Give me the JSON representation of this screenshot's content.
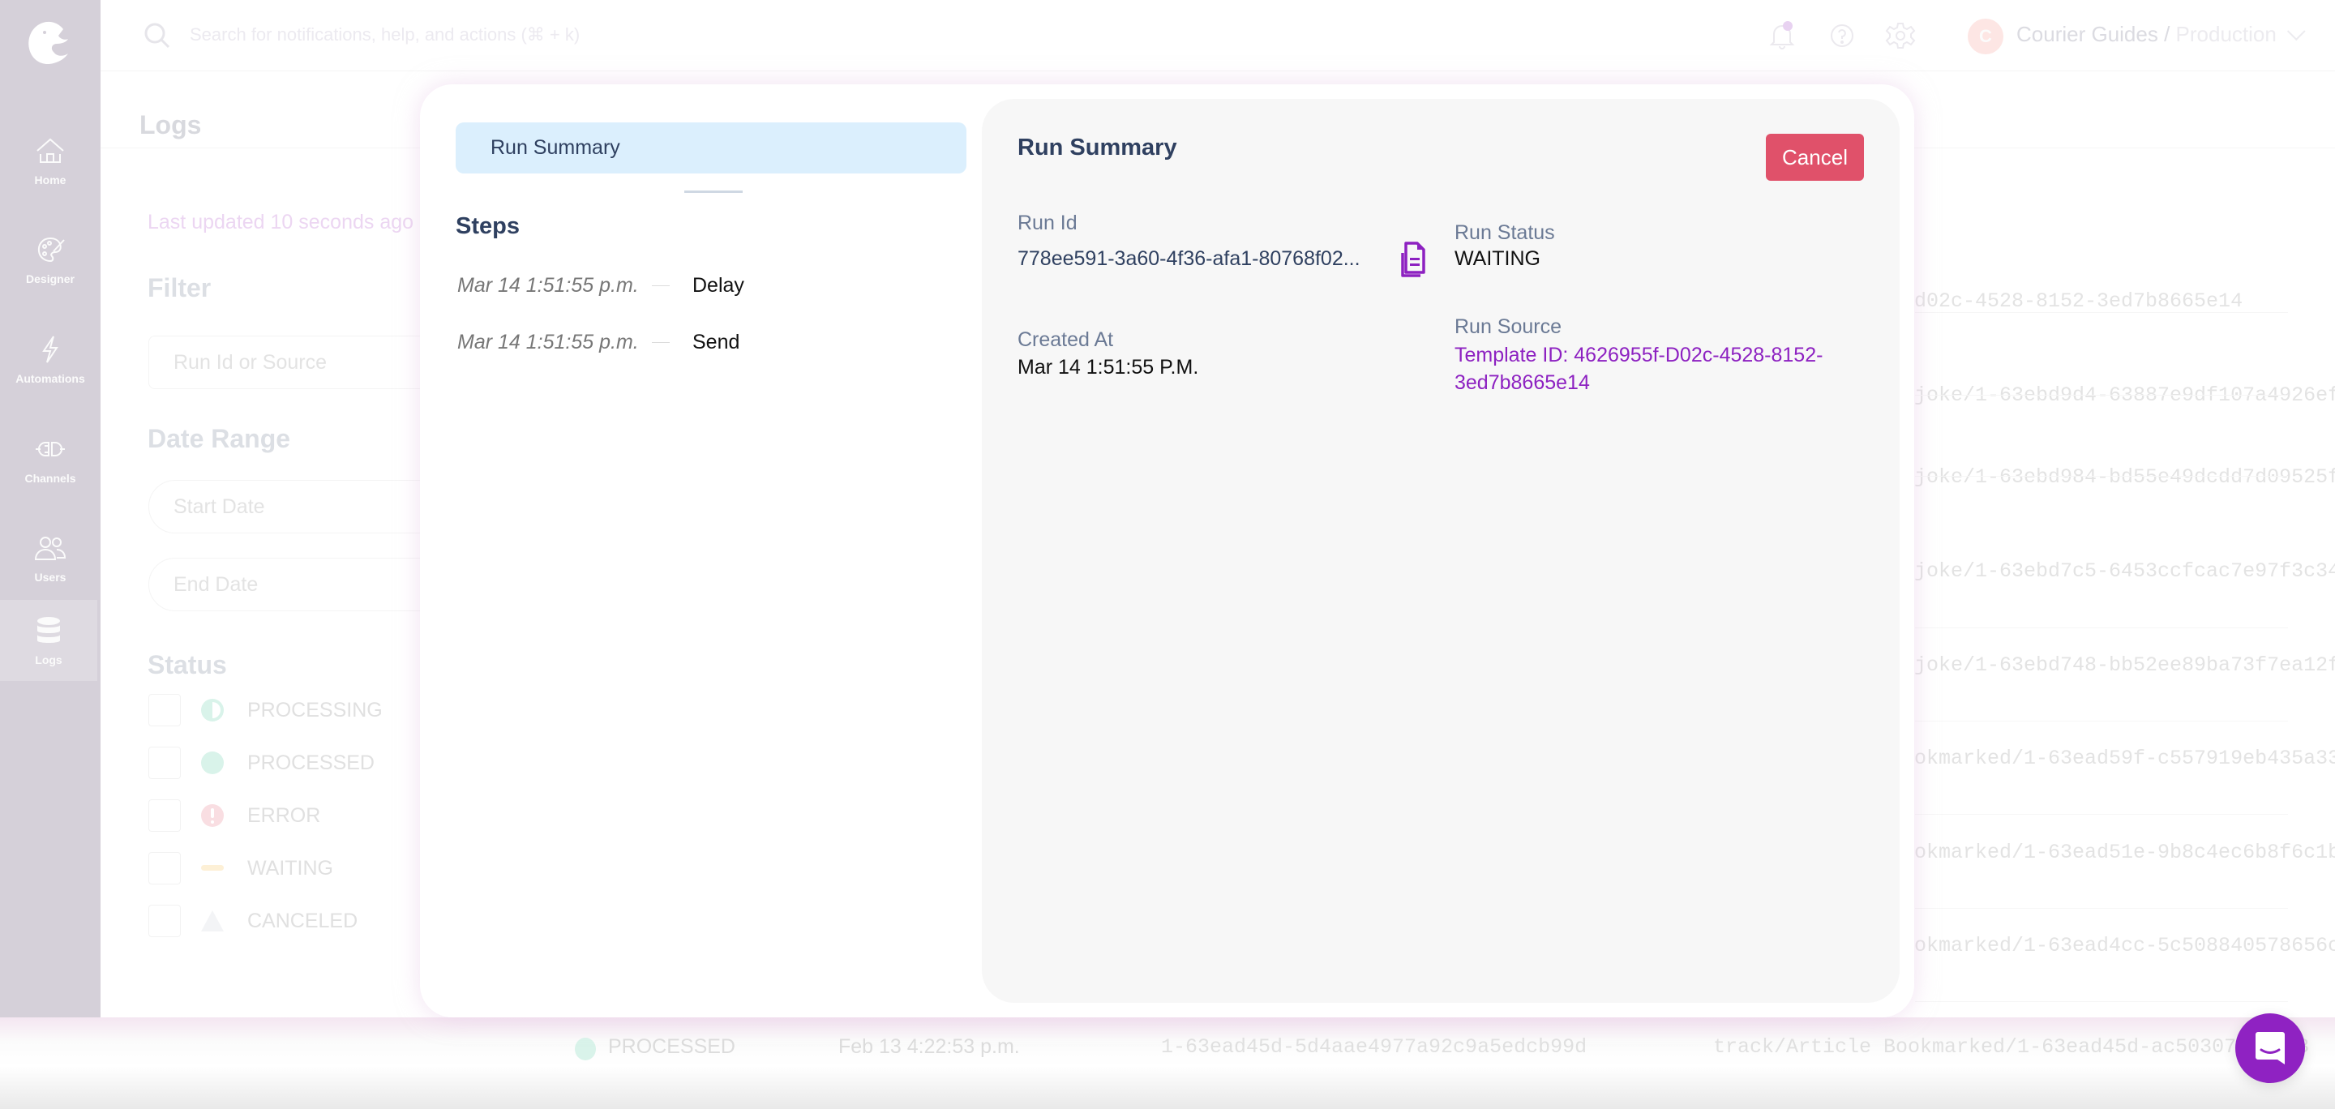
{
  "sidebar": {
    "logo": "courier-logo",
    "items": [
      {
        "label": "Home",
        "icon": "home-icon"
      },
      {
        "label": "Designer",
        "icon": "palette-icon"
      },
      {
        "label": "Automations",
        "icon": "lightning-icon"
      },
      {
        "label": "Channels",
        "icon": "plug-icon"
      },
      {
        "label": "Users",
        "icon": "users-icon"
      },
      {
        "label": "Logs",
        "icon": "database-icon",
        "active": true
      }
    ]
  },
  "topbar": {
    "search_placeholder": "Search for notifications, help, and actions (⌘ + k)",
    "avatar_initial": "C",
    "workspace": "Courier Guides",
    "separator": " / ",
    "environment": "Production"
  },
  "page": {
    "title": "Logs",
    "last_updated": "Last updated 10 seconds ago",
    "filter": {
      "title": "Filter",
      "search_placeholder": "Run Id or Source"
    },
    "date_range": {
      "title": "Date Range",
      "start_placeholder": "Start Date",
      "end_placeholder": "End Date"
    },
    "status": {
      "title": "Status",
      "options": [
        {
          "label": "PROCESSING",
          "icon": "half-circle-icon"
        },
        {
          "label": "PROCESSED",
          "icon": "filled-circle-icon"
        },
        {
          "label": "ERROR",
          "icon": "error-icon"
        },
        {
          "label": "WAITING",
          "icon": "dash-icon"
        },
        {
          "label": "CANCELED",
          "icon": "triangle-icon"
        }
      ]
    },
    "rows_partial_source": [
      "d02c-4528-8152-3ed7b8665e14",
      "joke/1-63ebd9d4-63887e9df107a4926ef",
      "joke/1-63ebd984-bd55e49dcdd7d09525f",
      "joke/1-63ebd7c5-6453ccfcac7e97f3c34",
      "joke/1-63ebd748-bb52ee89ba73f7ea12f",
      "okmarked/1-63ead59f-c557919eb435a33",
      "okmarked/1-63ead51e-9b8c4ec6b8f6c1b",
      "okmarked/1-63ead4cc-5c508840578656c"
    ],
    "last_row": {
      "status": "PROCESSED",
      "date": "Feb 13 4:22:53 p.m.",
      "run_id": "1-63ead45d-5d4aae4977a92c9a5edcb99d",
      "source": "track/Article Bookmarked/1-63ead45d-ac50307...433"
    }
  },
  "modal": {
    "tab_label": "Run Summary",
    "steps_title": "Steps",
    "steps": [
      {
        "time": "Mar 14 1:51:55 p.m.",
        "name": "Delay"
      },
      {
        "time": "Mar 14 1:51:55 p.m.",
        "name": "Send"
      }
    ],
    "summary": {
      "title": "Run Summary",
      "cancel_label": "Cancel",
      "run_id_label": "Run Id",
      "run_id_value": "778ee591-3a60-4f36-afa1-80768f02...",
      "run_status_label": "Run Status",
      "run_status_value": "WAITING",
      "created_at_label": "Created At",
      "created_at_value": "Mar 14 1:51:55 P.M.",
      "run_source_label": "Run Source",
      "run_source_value": "Template ID: 4626955f-D02c-4528-8152-3ed7b8665e14"
    }
  },
  "colors": {
    "accent_purple": "#8d21c1",
    "cancel_red": "#e0516a",
    "tab_active_bg": "#dbeffd",
    "heading_navy": "#2f4060"
  }
}
